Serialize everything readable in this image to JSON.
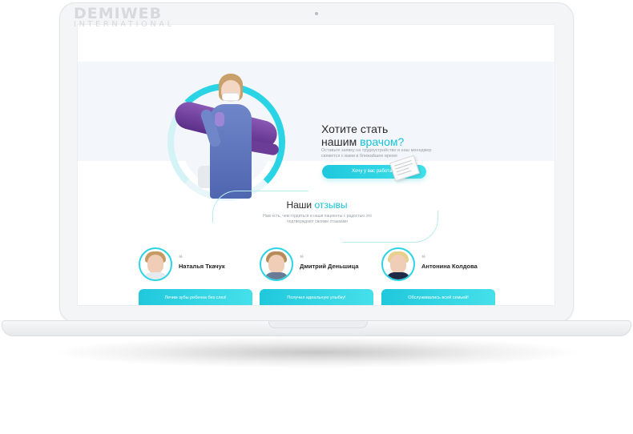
{
  "watermark": {
    "name": "DEMIWEB",
    "sub": "INTERNATIONAL"
  },
  "hero": {
    "title_line1": "Хотите стать",
    "title_line2": "нашим",
    "title_accent": "врачом?",
    "text": "Оставьте заявку на трудоустройство и наш менеджер свяжется с вами в ближайшее время",
    "button": "Хочу у вас работать"
  },
  "reviews": {
    "title": "Наши",
    "title_accent": "отзывы",
    "subtitle": "Нам есть, чем гордиться и наши пациенты с радостью это подтверждают своими отзывами",
    "quote_mark": "❝",
    "items": [
      {
        "name": "Наталья Ткачук",
        "headline": "Лечим зубы ребенка без слез!"
      },
      {
        "name": "Дмитрий Деньшица",
        "headline": "Получил идеальную улыбку!"
      },
      {
        "name": "Антонина Колдова",
        "headline": "Обслуживались всей семьей!"
      }
    ]
  },
  "colors": {
    "accent": "#17c2d6",
    "purple": "#6b3d97"
  }
}
